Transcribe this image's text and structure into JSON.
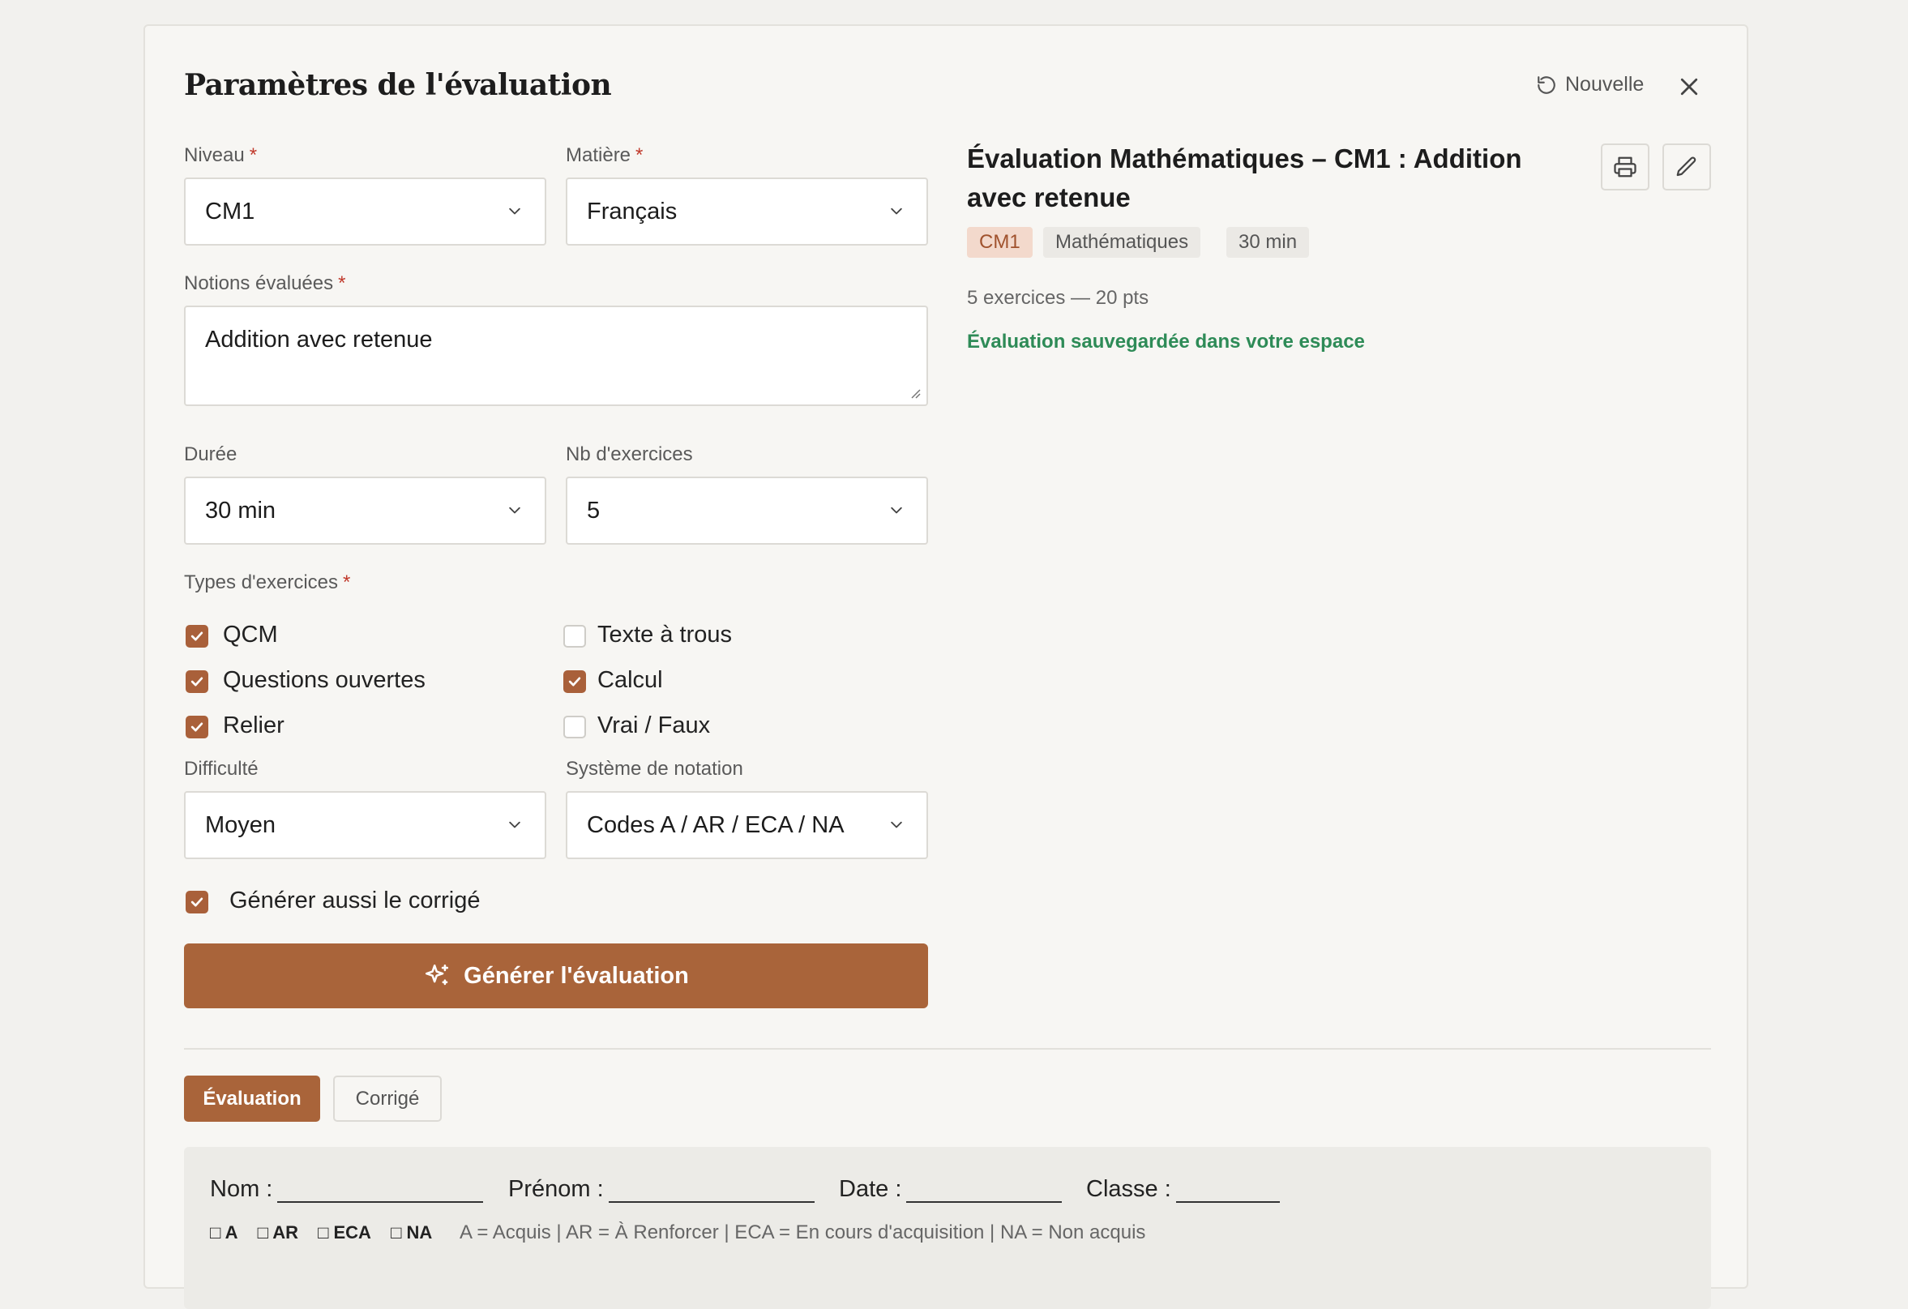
{
  "header": {
    "title": "Paramètres de l'évaluation",
    "new_label": "Nouvelle"
  },
  "form": {
    "niveau": {
      "label": "Niveau",
      "value": "CM1"
    },
    "matiere": {
      "label": "Matière",
      "value": "Français"
    },
    "notions": {
      "label": "Notions évaluées",
      "value": "Addition avec retenue"
    },
    "duree": {
      "label": "Durée",
      "value": "30 min"
    },
    "nb_exercices": {
      "label": "Nb d'exercices",
      "value": "5"
    },
    "types": {
      "label": "Types d'exercices",
      "items": [
        {
          "label": "QCM",
          "checked": true
        },
        {
          "label": "Texte à trous",
          "checked": false
        },
        {
          "label": "Questions ouvertes",
          "checked": true
        },
        {
          "label": "Calcul",
          "checked": true
        },
        {
          "label": "Relier",
          "checked": true
        },
        {
          "label": "Vrai / Faux",
          "checked": false
        }
      ]
    },
    "difficulte": {
      "label": "Difficulté",
      "value": "Moyen"
    },
    "notation": {
      "label": "Système de notation",
      "value": "Codes A / AR / ECA / NA"
    },
    "corrige": {
      "label": "Générer aussi le corrigé",
      "checked": true
    },
    "generate_label": "Générer l'évaluation",
    "required_mark": "*"
  },
  "result": {
    "title": "Évaluation Mathématiques – CM1 : Addition avec retenue",
    "chips": [
      "CM1",
      "Mathématiques",
      "30 min"
    ],
    "meta": "5 exercices — 20 pts",
    "saved": "Évaluation sauvegardée dans votre espace"
  },
  "tabs": {
    "active": "Évaluation",
    "other": "Corrigé"
  },
  "sheet": {
    "nom": "Nom :",
    "prenom": "Prénom :",
    "date": "Date :",
    "classe": "Classe :",
    "codes": [
      "□ A",
      "□ AR",
      "□ ECA",
      "□ NA"
    ],
    "legend": "A = Acquis | AR = À Renforcer | ECA = En cours d'acquisition | NA = Non acquis"
  },
  "colors": {
    "accent": "#a9643a",
    "success": "#2e8b57",
    "required": "#c0392b"
  }
}
